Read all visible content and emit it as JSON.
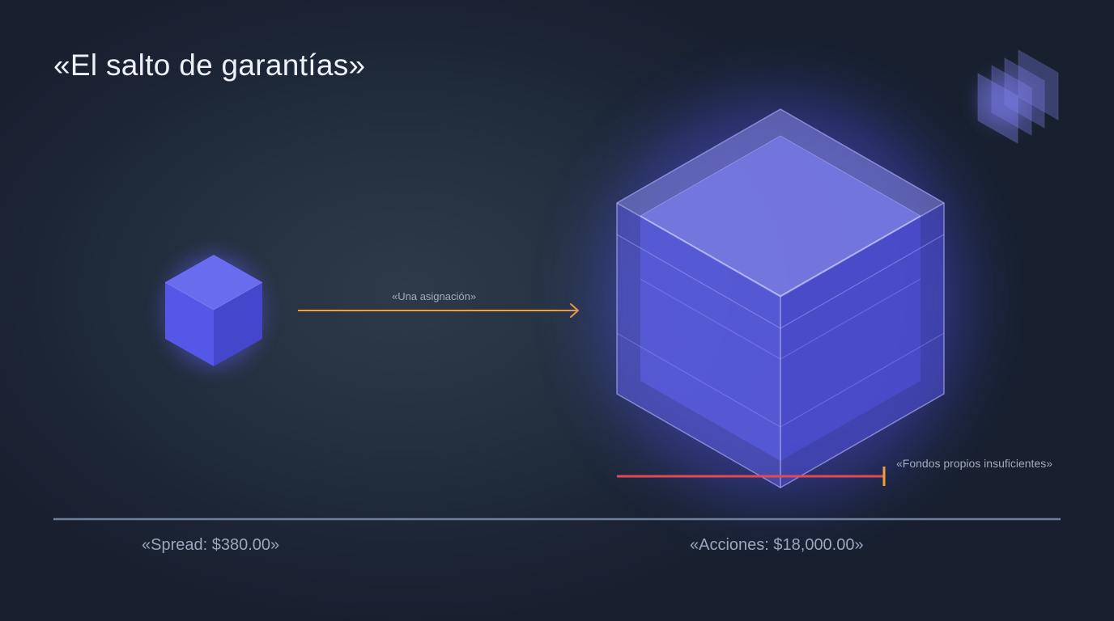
{
  "title": "«El salto de garantías»",
  "arrow_label": "«Una asignación»",
  "funds_label": "«Fondos propios insuficientes»",
  "small_block_label": "«Spread: $380.00»",
  "large_block_label": "«Acciones: $18,000.00»",
  "icons": {
    "small_block": "small-cube-icon",
    "large_block": "large-cube-icon",
    "stack": "stacked-layers-icon"
  },
  "colors": {
    "cube": "#5b5ce8",
    "arrow": "#f5a02e",
    "insufficient_line": "#e04b52",
    "marker": "#f5a02e",
    "baseline": "#6f7f99"
  }
}
